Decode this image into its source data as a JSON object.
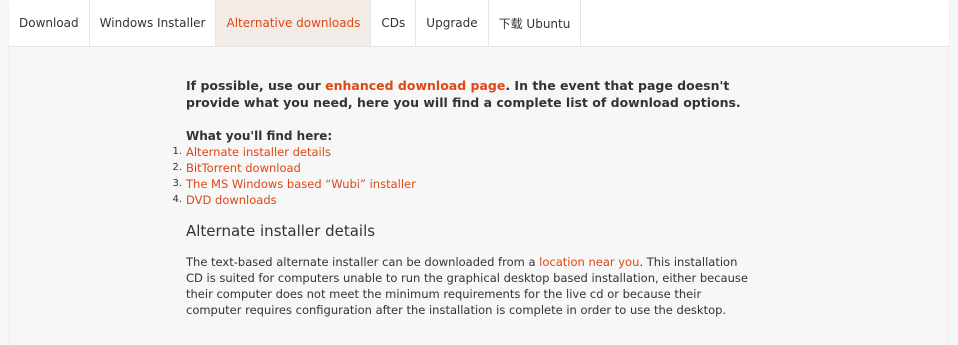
{
  "tabs": [
    {
      "label": "Download"
    },
    {
      "label": "Windows Installer"
    },
    {
      "label": "Alternative downloads"
    },
    {
      "label": "CDs"
    },
    {
      "label": "Upgrade"
    },
    {
      "label": "下载 Ubuntu"
    }
  ],
  "active_tab": "Alternative downloads",
  "colors": {
    "link": "#dd4814",
    "active_tab_bg": "#f3ece6",
    "page_bg": "#f7f7f7"
  },
  "intro": {
    "before": "If possible, use our ",
    "link": "enhanced download page",
    "after": ". In the event that page doesn't provide what you need, here you will find a complete list of download options."
  },
  "find_heading": "What you'll find here:",
  "toc": [
    {
      "num": "1.",
      "label": "Alternate installer details"
    },
    {
      "num": "2.",
      "label": "BitTorrent download"
    },
    {
      "num": "3.",
      "label": "The MS Windows based “Wubi” installer"
    },
    {
      "num": "4.",
      "label": "DVD downloads"
    }
  ],
  "section": {
    "title": "Alternate installer details",
    "body_before": "The text-based alternate installer can be downloaded from a ",
    "body_link": "location near you",
    "body_after": ". This installation CD is suited for computers unable to run the graphical desktop based installation, either because their computer does not meet the minimum requirements for the live cd or because their computer requires configuration after the installation is complete in order to use the desktop."
  }
}
